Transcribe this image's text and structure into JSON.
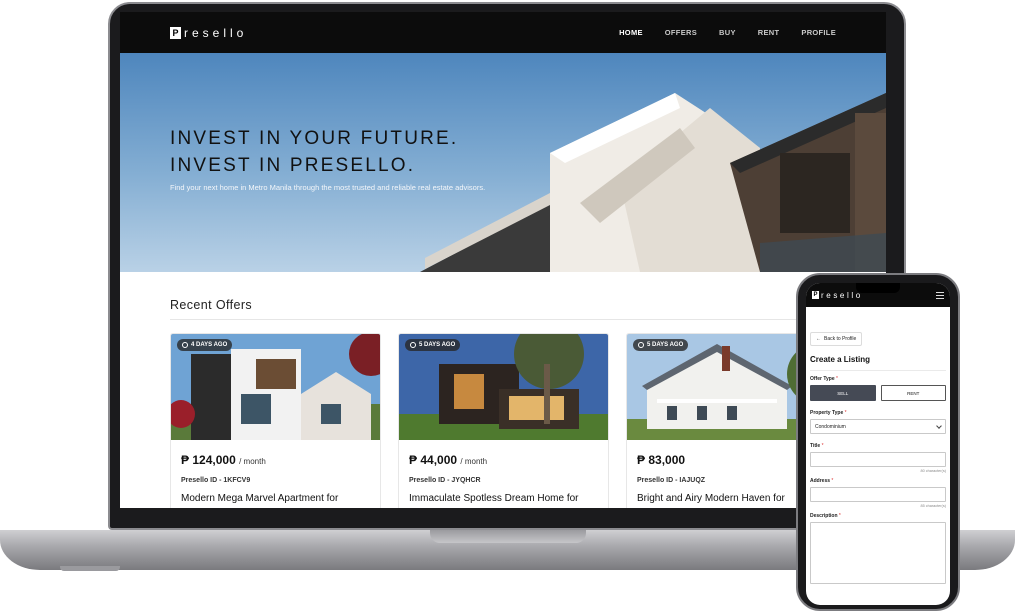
{
  "nav": {
    "logo_letter": "P",
    "logo_text": "resello",
    "links": [
      {
        "label": "HOME",
        "active": true
      },
      {
        "label": "OFFERS",
        "active": false
      },
      {
        "label": "BUY",
        "active": false
      },
      {
        "label": "RENT",
        "active": false
      },
      {
        "label": "PROFILE",
        "active": false
      }
    ]
  },
  "hero": {
    "headline_1": "INVEST IN YOUR FUTURE.",
    "headline_2": "INVEST IN PRESELLO.",
    "subtext": "Find your next home in Metro Manila through the most trusted and reliable real estate advisors."
  },
  "offers": {
    "title": "Recent Offers",
    "cards": [
      {
        "badge": "4 DAYS AGO",
        "currency": "₱",
        "price": "124,000",
        "period": "/ month",
        "id_label": "Presello ID - 1KFCV9",
        "title": "Modern Mega Marvel Apartment for"
      },
      {
        "badge": "5 DAYS AGO",
        "currency": "₱",
        "price": "44,000",
        "period": "/ month",
        "id_label": "Presello ID - JYQHCR",
        "title": "Immaculate Spotless Dream Home for"
      },
      {
        "badge": "5 DAYS AGO",
        "currency": "₱",
        "price": "83,000",
        "period": "",
        "id_label": "Presello ID - IAJUQZ",
        "title": "Bright and Airy Modern Haven for"
      }
    ]
  },
  "phone": {
    "logo_letter": "P",
    "logo_text": "resello",
    "back_label": "Back to Profile",
    "heading": "Create a Listing",
    "offer_type_label": "Offer Type",
    "sell_label": "SELL",
    "rent_label": "RENT",
    "property_type_label": "Property Type",
    "property_type_value": "Condominium",
    "title_label": "Title",
    "title_hint": "80 character(s)",
    "address_label": "Address",
    "address_hint": "85 character(s)",
    "description_label": "Description",
    "required_mark": "*"
  },
  "colors": {
    "nav_bg": "#0c0c0c",
    "hero_sky": "#6c9ccb",
    "toggle_active": "#454a55",
    "required": "#d33333"
  }
}
